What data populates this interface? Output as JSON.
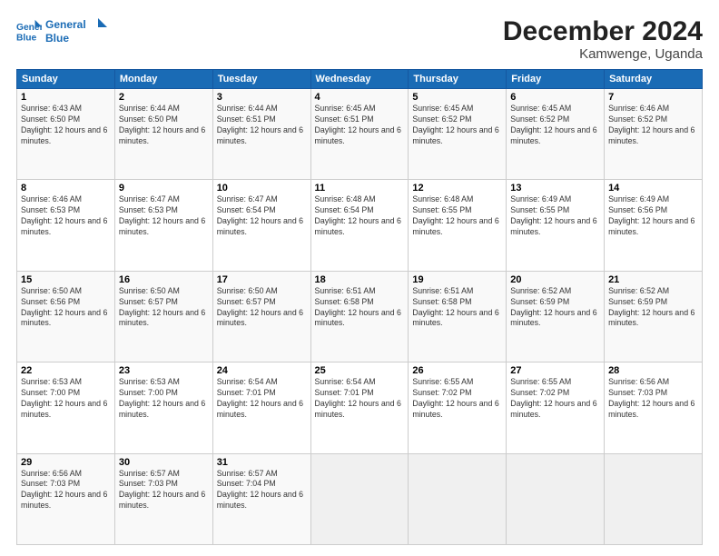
{
  "header": {
    "logo_line1": "General",
    "logo_line2": "Blue",
    "title": "December 2024",
    "subtitle": "Kamwenge, Uganda"
  },
  "weekdays": [
    "Sunday",
    "Monday",
    "Tuesday",
    "Wednesday",
    "Thursday",
    "Friday",
    "Saturday"
  ],
  "weeks": [
    [
      {
        "day": "1",
        "sunrise": "6:43 AM",
        "sunset": "6:50 PM",
        "daylight": "12 hours and 6 minutes."
      },
      {
        "day": "2",
        "sunrise": "6:44 AM",
        "sunset": "6:50 PM",
        "daylight": "12 hours and 6 minutes."
      },
      {
        "day": "3",
        "sunrise": "6:44 AM",
        "sunset": "6:51 PM",
        "daylight": "12 hours and 6 minutes."
      },
      {
        "day": "4",
        "sunrise": "6:45 AM",
        "sunset": "6:51 PM",
        "daylight": "12 hours and 6 minutes."
      },
      {
        "day": "5",
        "sunrise": "6:45 AM",
        "sunset": "6:52 PM",
        "daylight": "12 hours and 6 minutes."
      },
      {
        "day": "6",
        "sunrise": "6:45 AM",
        "sunset": "6:52 PM",
        "daylight": "12 hours and 6 minutes."
      },
      {
        "day": "7",
        "sunrise": "6:46 AM",
        "sunset": "6:52 PM",
        "daylight": "12 hours and 6 minutes."
      }
    ],
    [
      {
        "day": "8",
        "sunrise": "6:46 AM",
        "sunset": "6:53 PM",
        "daylight": "12 hours and 6 minutes."
      },
      {
        "day": "9",
        "sunrise": "6:47 AM",
        "sunset": "6:53 PM",
        "daylight": "12 hours and 6 minutes."
      },
      {
        "day": "10",
        "sunrise": "6:47 AM",
        "sunset": "6:54 PM",
        "daylight": "12 hours and 6 minutes."
      },
      {
        "day": "11",
        "sunrise": "6:48 AM",
        "sunset": "6:54 PM",
        "daylight": "12 hours and 6 minutes."
      },
      {
        "day": "12",
        "sunrise": "6:48 AM",
        "sunset": "6:55 PM",
        "daylight": "12 hours and 6 minutes."
      },
      {
        "day": "13",
        "sunrise": "6:49 AM",
        "sunset": "6:55 PM",
        "daylight": "12 hours and 6 minutes."
      },
      {
        "day": "14",
        "sunrise": "6:49 AM",
        "sunset": "6:56 PM",
        "daylight": "12 hours and 6 minutes."
      }
    ],
    [
      {
        "day": "15",
        "sunrise": "6:50 AM",
        "sunset": "6:56 PM",
        "daylight": "12 hours and 6 minutes."
      },
      {
        "day": "16",
        "sunrise": "6:50 AM",
        "sunset": "6:57 PM",
        "daylight": "12 hours and 6 minutes."
      },
      {
        "day": "17",
        "sunrise": "6:50 AM",
        "sunset": "6:57 PM",
        "daylight": "12 hours and 6 minutes."
      },
      {
        "day": "18",
        "sunrise": "6:51 AM",
        "sunset": "6:58 PM",
        "daylight": "12 hours and 6 minutes."
      },
      {
        "day": "19",
        "sunrise": "6:51 AM",
        "sunset": "6:58 PM",
        "daylight": "12 hours and 6 minutes."
      },
      {
        "day": "20",
        "sunrise": "6:52 AM",
        "sunset": "6:59 PM",
        "daylight": "12 hours and 6 minutes."
      },
      {
        "day": "21",
        "sunrise": "6:52 AM",
        "sunset": "6:59 PM",
        "daylight": "12 hours and 6 minutes."
      }
    ],
    [
      {
        "day": "22",
        "sunrise": "6:53 AM",
        "sunset": "7:00 PM",
        "daylight": "12 hours and 6 minutes."
      },
      {
        "day": "23",
        "sunrise": "6:53 AM",
        "sunset": "7:00 PM",
        "daylight": "12 hours and 6 minutes."
      },
      {
        "day": "24",
        "sunrise": "6:54 AM",
        "sunset": "7:01 PM",
        "daylight": "12 hours and 6 minutes."
      },
      {
        "day": "25",
        "sunrise": "6:54 AM",
        "sunset": "7:01 PM",
        "daylight": "12 hours and 6 minutes."
      },
      {
        "day": "26",
        "sunrise": "6:55 AM",
        "sunset": "7:02 PM",
        "daylight": "12 hours and 6 minutes."
      },
      {
        "day": "27",
        "sunrise": "6:55 AM",
        "sunset": "7:02 PM",
        "daylight": "12 hours and 6 minutes."
      },
      {
        "day": "28",
        "sunrise": "6:56 AM",
        "sunset": "7:03 PM",
        "daylight": "12 hours and 6 minutes."
      }
    ],
    [
      {
        "day": "29",
        "sunrise": "6:56 AM",
        "sunset": "7:03 PM",
        "daylight": "12 hours and 6 minutes."
      },
      {
        "day": "30",
        "sunrise": "6:57 AM",
        "sunset": "7:03 PM",
        "daylight": "12 hours and 6 minutes."
      },
      {
        "day": "31",
        "sunrise": "6:57 AM",
        "sunset": "7:04 PM",
        "daylight": "12 hours and 6 minutes."
      },
      null,
      null,
      null,
      null
    ]
  ]
}
